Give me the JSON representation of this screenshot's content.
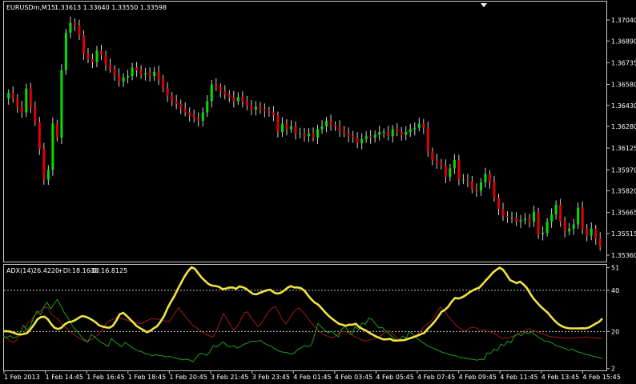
{
  "header": {
    "symbol_timeframe": "EURUSDm,M15",
    "ohlc": "1.33613 1.33640 1.33550 1.33598"
  },
  "indicator": {
    "title": "ADX(14)",
    "adx_value": "26.4220",
    "plus_di": "+DI:18.1630",
    "minus_di": "-DI:16.8125"
  },
  "colors": {
    "background": "#000000",
    "frame": "#c8c8c8",
    "bull": "#00e000",
    "bear": "#e00000",
    "wick": "#d0d0d0",
    "adx": "#f0e442",
    "plus_di": "#1aa01a",
    "minus_di": "#a01818",
    "level_line": "#bfbfbf"
  },
  "icons": {
    "scroll_marker": "triangle-down-icon"
  },
  "chart_data": [
    {
      "type": "candlestick",
      "title": "EURUSDm,M15",
      "y_ticks": [
        "1.37040",
        "1.36890",
        "1.36735",
        "1.36580",
        "1.36430",
        "1.36280",
        "1.36125",
        "1.35970",
        "1.35820",
        "1.35665",
        "1.35515",
        "1.35360"
      ],
      "ylim": [
        1.3532,
        1.3716
      ],
      "x_ticks": [
        "1 Feb 2013",
        "1 Feb 14:45",
        "1 Feb 16:45",
        "1 Feb 18:45",
        "1 Feb 20:45",
        "3 Feb 21:45",
        "3 Feb 23:45",
        "4 Feb 01:45",
        "4 Feb 03:45",
        "4 Feb 05:45",
        "4 Feb 07:45",
        "4 Feb 09:45",
        "4 Feb 11:45",
        "4 Feb 13:45",
        "4 Feb 15:45"
      ],
      "close": [
        1.3652,
        1.3648,
        1.3642,
        1.3638,
        1.3655,
        1.3642,
        1.3631,
        1.3612,
        1.359,
        1.3597,
        1.363,
        1.362,
        1.3668,
        1.3695,
        1.3702,
        1.37,
        1.3693,
        1.368,
        1.3676,
        1.3674,
        1.3682,
        1.3679,
        1.3672,
        1.3669,
        1.3665,
        1.366,
        1.3663,
        1.3664,
        1.367,
        1.3668,
        1.3665,
        1.3666,
        1.3664,
        1.3667,
        1.3662,
        1.3655,
        1.365,
        1.3646,
        1.3644,
        1.3641,
        1.3638,
        1.3636,
        1.3634,
        1.3632,
        1.3638,
        1.3646,
        1.3658,
        1.3656,
        1.3653,
        1.3651,
        1.3649,
        1.3646,
        1.3649,
        1.3646,
        1.3643,
        1.364,
        1.3642,
        1.364,
        1.3639,
        1.3638,
        1.3636,
        1.3624,
        1.363,
        1.3626,
        1.3628,
        1.3623,
        1.3623,
        1.3621,
        1.3623,
        1.362,
        1.3626,
        1.3628,
        1.3632,
        1.3629,
        1.3628,
        1.3625,
        1.3623,
        1.3621,
        1.362,
        1.3616,
        1.3619,
        1.3621,
        1.362,
        1.3622,
        1.3624,
        1.3624,
        1.3621,
        1.3626,
        1.3624,
        1.3622,
        1.3624,
        1.3626,
        1.3627,
        1.363,
        1.3627,
        1.361,
        1.3604,
        1.3602,
        1.36,
        1.3592,
        1.3598,
        1.3604,
        1.359,
        1.359,
        1.3589,
        1.3583,
        1.3582,
        1.3588,
        1.3594,
        1.3588,
        1.3577,
        1.3569,
        1.3564,
        1.3563,
        1.3563,
        1.356,
        1.3561,
        1.3562,
        1.356,
        1.3567,
        1.3551,
        1.3552,
        1.356,
        1.3565,
        1.3572,
        1.356,
        1.3553,
        1.3555,
        1.3558,
        1.357,
        1.3555,
        1.355,
        1.3555,
        1.3548,
        1.3542
      ],
      "grid": false
    },
    {
      "type": "line",
      "title": "ADX(14) 26.4220 +DI:18.1630 -DI:16.8125",
      "y_ticks": [
        51,
        40,
        20,
        2
      ],
      "ylim": [
        1.5,
        52
      ],
      "levels": [
        40,
        20
      ],
      "series": [
        {
          "name": "ADX(14)",
          "values": [
            20.1,
            20.2,
            20.0,
            19.4,
            18.8,
            18.5,
            18.8,
            19.2,
            21.2,
            23.4,
            25.9,
            27.0,
            27.2,
            26.0,
            23.7,
            21.8,
            21.2,
            21.8,
            23.5,
            24.5,
            24.8,
            25.5,
            26.6,
            27.5,
            27.2,
            26.5,
            25.6,
            24.5,
            23.0,
            22.4,
            22.0,
            21.8,
            22.7,
            25.2,
            28.3,
            29.1,
            27.7,
            26.0,
            24.4,
            22.6,
            21.6,
            20.6,
            19.6,
            20.4,
            21.6,
            22.6,
            24.9,
            27.6,
            31.4,
            34.4,
            37.2,
            40.6,
            43.8,
            46.8,
            49.3,
            51.2,
            50.4,
            48.2,
            46.1,
            44.5,
            43.0,
            42.3,
            42.1,
            41.7,
            40.6,
            40.8,
            41.3,
            41.4,
            40.7,
            41.9,
            41.5,
            40.7,
            39.4,
            38.2,
            38.1,
            38.8,
            39.4,
            40.0,
            40.3,
            39.0,
            38.4,
            38.7,
            39.8,
            41.2,
            42.0,
            41.4,
            41.4,
            41.0,
            39.8,
            37.6,
            35.6,
            34.0,
            33.1,
            31.3,
            29.4,
            27.7,
            26.3,
            25.0,
            23.8,
            23.3,
            22.8,
            23.3,
            23.3,
            23.8,
            22.1,
            21.2,
            20.4,
            19.3,
            18.4,
            17.5,
            16.8,
            16.2,
            16.2,
            16.4,
            15.6,
            15.6,
            15.7,
            15.8,
            16.3,
            16.8,
            17.4,
            18.0,
            18.7,
            19.3,
            21.3,
            22.9,
            24.8,
            27.0,
            29.5,
            30.5,
            32.1,
            34.5,
            36.3,
            36.0,
            36.6,
            37.5,
            38.8,
            39.8,
            40.7,
            41.2,
            43.0,
            44.9,
            46.6,
            48.6,
            49.9,
            51.0,
            50.0,
            47.7,
            45.0,
            44.2,
            43.5,
            44.2,
            42.8,
            41.0,
            38.2,
            35.8,
            33.9,
            32.1,
            30.6,
            29.2,
            27.2,
            25.3,
            23.8,
            22.7,
            22.0,
            21.6,
            21.5,
            21.5,
            21.5,
            21.6,
            21.5,
            21.9,
            22.8,
            23.8,
            24.6,
            26.3
          ]
        },
        {
          "name": "+DI",
          "values": [
            17.8,
            17.0,
            18.0,
            16.8,
            17.5,
            19.5,
            23.0,
            20.7,
            22.5,
            26.7,
            30.0,
            28.1,
            31.8,
            34.2,
            31.0,
            33.4,
            35.6,
            32.5,
            29.2,
            27.0,
            24.0,
            21.5,
            19.8,
            17.6,
            16.0,
            14.8,
            18.6,
            17.4,
            16.0,
            14.6,
            13.8,
            12.8,
            16.6,
            14.9,
            13.8,
            12.6,
            14.7,
            13.6,
            12.3,
            11.3,
            10.6,
            10.1,
            9.3,
            9.0,
            8.2,
            8.7,
            8.4,
            8.3,
            7.6,
            8.0,
            7.6,
            7.0,
            6.8,
            6.2,
            6.6,
            6.2,
            5.3,
            7.2,
            9.4,
            9.2,
            8.4,
            9.9,
            13.1,
            12.5,
            13.6,
            15.0,
            13.3,
            12.5,
            13.1,
            12.0,
            12.5,
            13.7,
            14.3,
            15.1,
            15.3,
            15.2,
            15.7,
            14.4,
            13.5,
            13.0,
            11.8,
            10.9,
            10.2,
            9.9,
            9.7,
            9.0,
            9.5,
            11.2,
            12.1,
            13.1,
            12.6,
            13.3,
            18.3,
            24.0,
            22.2,
            20.7,
            19.2,
            20.3,
            18.6,
            17.4,
            21.1,
            22.5,
            20.2,
            18.5,
            22.6,
            20.6,
            24.2,
            23.4,
            26.5,
            25.9,
            23.7,
            21.7,
            22.0,
            20.2,
            18.8,
            17.4,
            16.1,
            15.6,
            17.8,
            16.7,
            20.1,
            18.5,
            17.1,
            15.8,
            14.6,
            13.5,
            12.6,
            11.9,
            11.2,
            10.4,
            9.7,
            9.3,
            8.7,
            8.3,
            8.0,
            7.4,
            7.2,
            6.9,
            6.6,
            6.4,
            6.1,
            6.5,
            6.3,
            9.6,
            9.2,
            11.5,
            10.8,
            13.9,
            13.1,
            15.4,
            14.5,
            17.6,
            18.9,
            17.9,
            19.6,
            19.0,
            19.8,
            18.5,
            17.4,
            16.4,
            15.3,
            15.3,
            14.5,
            13.6,
            12.8,
            12.3,
            11.7,
            10.9,
            11.5,
            10.6,
            10.0,
            9.5,
            8.9,
            8.6,
            8.1,
            7.7,
            7.3,
            6.9
          ]
        },
        {
          "name": "-DI",
          "values": [
            17.7,
            16.7,
            15.4,
            14.6,
            16.2,
            18.5,
            19.0,
            24.2,
            24.9,
            27.8,
            29.0,
            30.2,
            31.6,
            31.6,
            28.4,
            27.0,
            25.9,
            23.9,
            22.1,
            20.7,
            19.2,
            18.0,
            16.8,
            15.9,
            15.3,
            15.6,
            16.5,
            17.8,
            19.3,
            21.1,
            24.2,
            25.3,
            26.0,
            27.1,
            26.6,
            26.0,
            25.4,
            24.9,
            24.4,
            24.0,
            23.8,
            24.6,
            25.5,
            26.2,
            26.1,
            26.0,
            25.6,
            25.1,
            24.6,
            26.6,
            29.3,
            31.7,
            29.1,
            27.1,
            25.1,
            23.0,
            22.0,
            20.8,
            19.6,
            18.6,
            17.8,
            17.4,
            20.4,
            24.7,
            28.8,
            25.8,
            23.1,
            20.5,
            22.6,
            25.6,
            29.1,
            29.6,
            26.6,
            24.5,
            22.3,
            24.1,
            26.8,
            29.4,
            31.2,
            32.2,
            29.4,
            26.0,
            23.6,
            25.8,
            28.5,
            30.8,
            31.4,
            29.5,
            27.6,
            25.3,
            23.2,
            21.5,
            19.8,
            18.8,
            17.9,
            17.1,
            17.2,
            18.5,
            19.8,
            20.1,
            19.5,
            18.6,
            17.6,
            16.9,
            16.0,
            15.5,
            15.6,
            16.2,
            16.6,
            17.4,
            18.2,
            19.7,
            20.4,
            18.9,
            17.5,
            16.3,
            15.6,
            15.6,
            16.3,
            17.1,
            18.3,
            19.7,
            22.0,
            23.4,
            24.5,
            26.8,
            29.6,
            31.9,
            30.4,
            28.0,
            25.8,
            24.0,
            22.3,
            21.0,
            20.0,
            21.1,
            22.1,
            22.0,
            21.2,
            20.8,
            20.8,
            20.1,
            19.4,
            18.8,
            17.6,
            16.6,
            16.8,
            17.1,
            17.6,
            18.4,
            19.2,
            20.2,
            21.1,
            21.2,
            20.4,
            19.8,
            19.2,
            18.6,
            18.0,
            17.5,
            17.3,
            17.2,
            17.0,
            16.9,
            16.8,
            16.9,
            17.0,
            17.1,
            17.2,
            17.3,
            17.2,
            17.1,
            16.9,
            16.8,
            16.8
          ]
        }
      ],
      "grid": false
    }
  ]
}
